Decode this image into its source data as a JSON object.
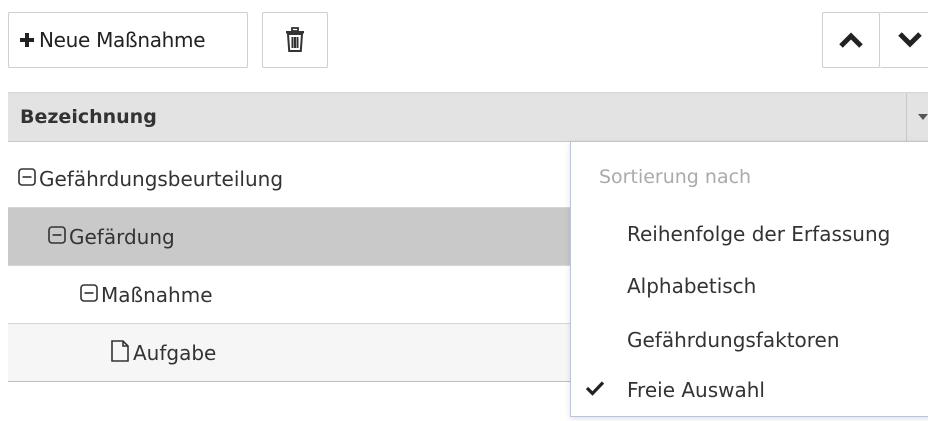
{
  "toolbar": {
    "new_label": "Neue Maßnahme",
    "delete_icon": "trash-icon",
    "up_icon": "chevron-up-icon",
    "down_icon": "chevron-down-icon"
  },
  "grid": {
    "column_header": "Bezeichnung",
    "rows": [
      {
        "label": "Gefährdungsbeurteilung",
        "icon": "collapse-icon"
      },
      {
        "label": "Gefärdung",
        "icon": "collapse-icon",
        "selected": true
      },
      {
        "label": "Maßnahme",
        "icon": "collapse-icon"
      },
      {
        "label": "Aufgabe",
        "icon": "document-icon"
      }
    ]
  },
  "sort_menu": {
    "heading": "Sortierung nach",
    "options": [
      {
        "label": "Reihenfolge der Erfassung",
        "checked": false
      },
      {
        "label": "Alphabetisch",
        "checked": false
      },
      {
        "label": "Gefährdungsfaktoren",
        "checked": false
      },
      {
        "label": "Freie Auswahl",
        "checked": true
      }
    ]
  },
  "colors": {
    "header_bg": "#e3e3e3",
    "selected_row_bg": "#c9c9c9",
    "dropdown_border": "#b8c6d8"
  }
}
